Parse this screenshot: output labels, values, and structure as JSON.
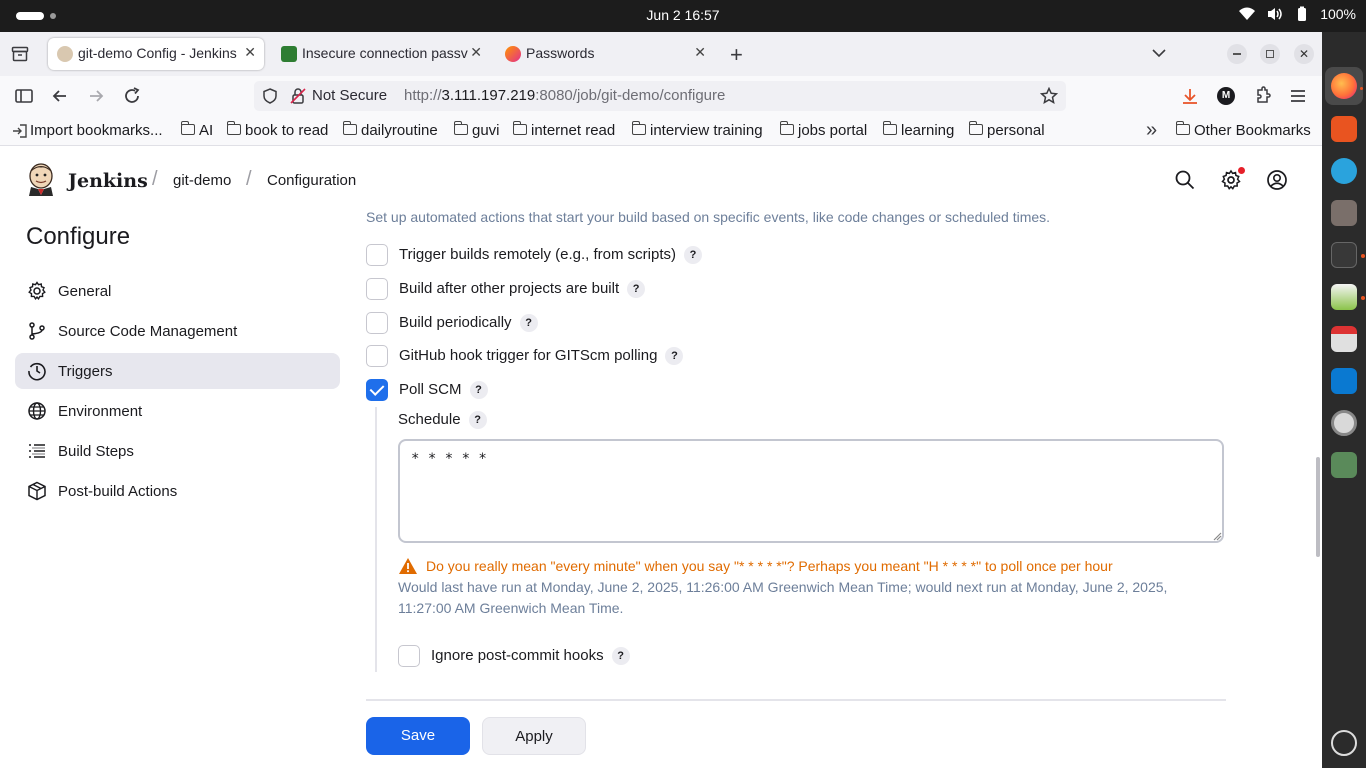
{
  "os": {
    "clock": "Jun 2  16:57",
    "battery": "100%"
  },
  "browser": {
    "tabs": [
      {
        "label": "git-demo Config - Jenkins",
        "active": true
      },
      {
        "label": "Insecure connection passv",
        "active": false
      },
      {
        "label": "Passwords",
        "active": false
      }
    ],
    "security_label": "Not Secure",
    "url_prefix": "http://",
    "url_host": "3.111.197.219",
    "url_path": ":8080/job/git-demo/configure",
    "bookmarks": [
      "Import bookmarks...",
      "AI",
      "book to read",
      "dailyroutine",
      "guvi",
      "internet read",
      "interview training",
      "jobs portal",
      "learning",
      "personal"
    ],
    "overflow_glyph": "»",
    "other_bookmarks": "Other Bookmarks"
  },
  "jenkins": {
    "brand": "Jenkins",
    "breadcrumbs": [
      "git-demo",
      "Configuration"
    ],
    "configure_title": "Configure",
    "sidebar": [
      {
        "label": "General",
        "icon": "gear-icon"
      },
      {
        "label": "Source Code Management",
        "icon": "branch-icon"
      },
      {
        "label": "Triggers",
        "icon": "clock-icon",
        "active": true
      },
      {
        "label": "Environment",
        "icon": "globe-icon"
      },
      {
        "label": "Build Steps",
        "icon": "list-icon"
      },
      {
        "label": "Post-build Actions",
        "icon": "package-icon"
      }
    ],
    "triggers": {
      "description": "Set up automated actions that start your build based on specific events, like code changes or scheduled times.",
      "options": [
        {
          "label": "Trigger builds remotely (e.g., from scripts)",
          "checked": false
        },
        {
          "label": "Build after other projects are built",
          "checked": false
        },
        {
          "label": "Build periodically",
          "checked": false
        },
        {
          "label": "GitHub hook trigger for GITScm polling",
          "checked": false
        },
        {
          "label": "Poll SCM",
          "checked": true
        }
      ],
      "help_glyph": "?",
      "schedule_label": "Schedule",
      "schedule_value": "* * * * *",
      "warning": "Do you really mean \"every minute\" when you say \"* * * * *\"? Perhaps you meant \"H * * * *\" to poll once per hour",
      "run_info": "Would last have run at Monday, June 2, 2025, 11:26:00 AM Greenwich Mean Time; would next run at Monday, June 2, 2025, 11:27:00 AM Greenwich Mean Time.",
      "ignore_post_commit": {
        "label": "Ignore post-commit hooks",
        "checked": false
      }
    },
    "buttons": {
      "save": "Save",
      "apply": "Apply"
    }
  },
  "colors": {
    "primary": "#1a64e8",
    "warning": "#e06b00",
    "muted_text": "#6d7f9a",
    "active_nav": "#e7e7ee"
  }
}
